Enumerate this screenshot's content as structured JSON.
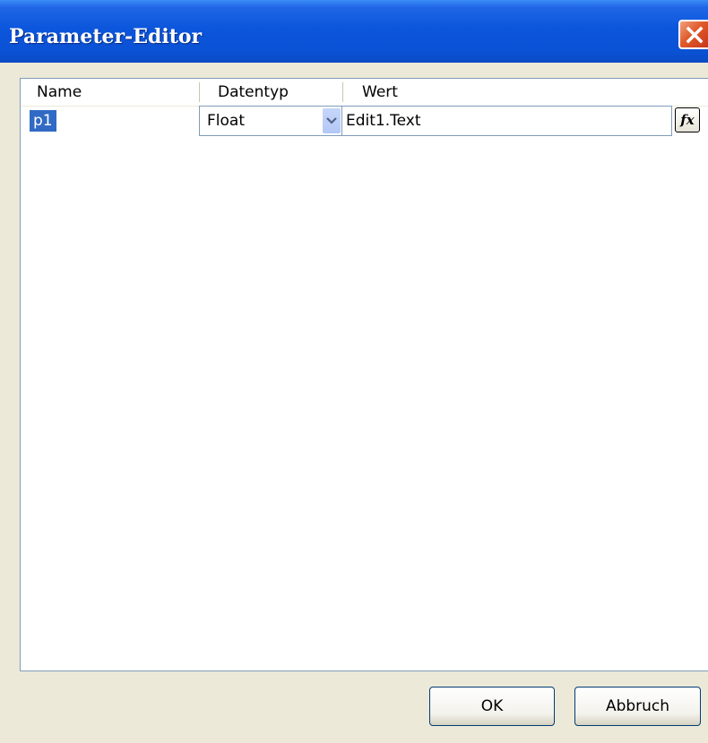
{
  "window": {
    "title": "Parameter-Editor"
  },
  "grid": {
    "columns": [
      "Name",
      "Datentyp",
      "Wert"
    ],
    "rows": [
      {
        "name": "p1",
        "type": "Float",
        "value": "Edit1.Text"
      }
    ],
    "fx_label": "fx"
  },
  "buttons": {
    "ok": "OK",
    "cancel": "Abbruch"
  },
  "colors": {
    "titlebar": "#0a52d6",
    "selection": "#316ac5",
    "dialog_bg": "#ece9d8"
  }
}
